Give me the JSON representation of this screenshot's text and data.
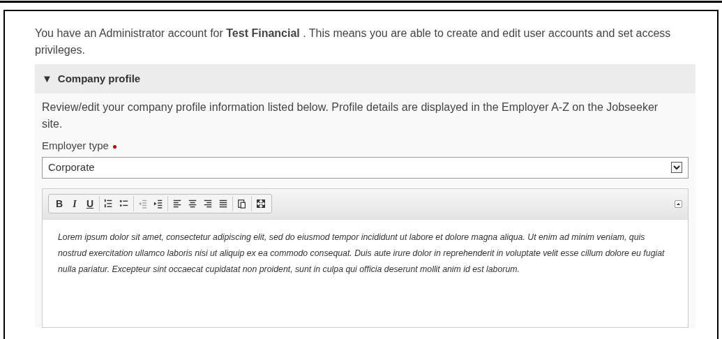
{
  "intro": "You have an Administrator account for **Test Financial** . This means you are able to create and edit user accounts and set access privileges.",
  "section": {
    "toggle": "▼",
    "title": "Company profile",
    "description": "Review/edit your company profile information listed below. Profile details are displayed in the Employer A-Z on the Jobseeker site.",
    "field": {
      "label": "Employer type",
      "required": true,
      "value": "Corporate"
    },
    "editor": {
      "toolbar": [
        {
          "kind": "text",
          "label": "B",
          "disabled": false
        },
        {
          "kind": "text",
          "label": "I",
          "disabled": false
        },
        {
          "kind": "text",
          "label": "U",
          "disabled": false
        },
        {
          "kind": "icon",
          "disabled": false
        },
        {
          "kind": "icon",
          "disabled": false
        },
        {
          "kind": "icon",
          "disabled": true
        },
        {
          "kind": "icon",
          "disabled": false
        },
        {
          "kind": "icon",
          "disabled": false
        },
        {
          "kind": "icon",
          "disabled": false
        },
        {
          "kind": "icon",
          "disabled": false
        },
        {
          "kind": "icon",
          "disabled": false
        },
        {
          "kind": "icon",
          "disabled": false
        },
        {
          "kind": "icon",
          "disabled": false
        }
      ],
      "content": "Lorem ipsum dolor sit amet, consectetur adipiscing elit, sed do eiusmod tempor incididunt ut labore et dolore magna aliqua. Ut enim ad minim veniam, quis nostrud exercitation ullamco laboris nisi ut aliquip ex ea commodo consequat. Duis aute irure dolor in reprehenderit in voluptate velit esse cillum dolore eu fugiat nulla pariatur. Excepteur sint occaecat cupidatat non proident, sunt in culpa qui officia deserunt mollit anim id est laborum."
    }
  }
}
